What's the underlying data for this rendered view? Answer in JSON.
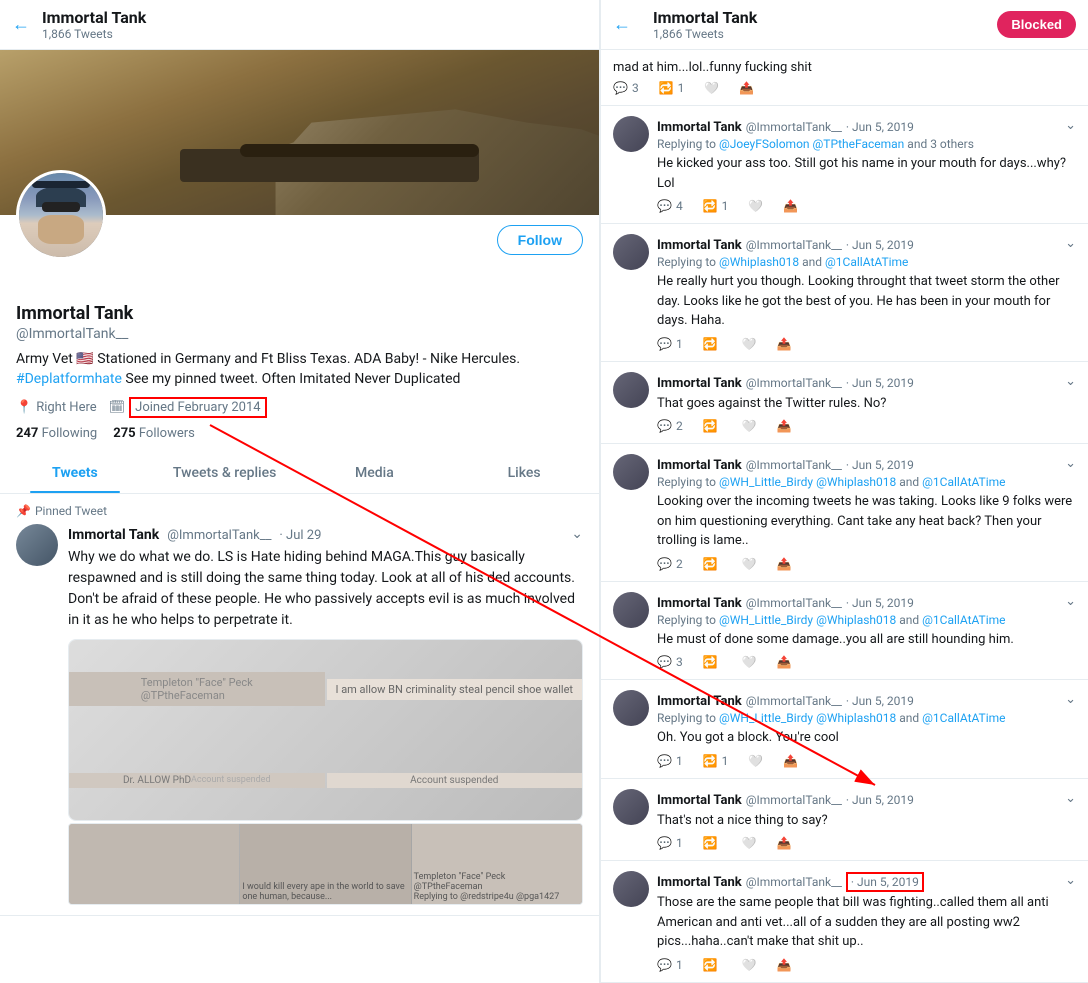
{
  "left": {
    "back_label": "←",
    "header": {
      "name": "Immortal Tank",
      "tweets_count": "1,866 Tweets"
    },
    "cover": "tank_cover",
    "avatar": "immortal_tank_avatar",
    "follow_label": "Follow",
    "profile": {
      "display_name": "Immortal Tank",
      "handle": "@ImmortalTank__",
      "bio": "Army Vet 🇺🇸 Stationed in Germany and Ft Bliss Texas. ADA Baby! - Nike Hercules. #Deplatformhate See my pinned tweet. Often Imitated Never Duplicated",
      "location": "Right Here",
      "joined": "Joined February 2014",
      "following_count": "247",
      "following_label": "Following",
      "followers_count": "275",
      "followers_label": "Followers"
    },
    "tabs": [
      {
        "label": "Tweets",
        "active": true
      },
      {
        "label": "Tweets & replies",
        "active": false
      },
      {
        "label": "Media",
        "active": false
      },
      {
        "label": "Likes",
        "active": false
      }
    ],
    "pinned_label": "Pinned Tweet",
    "pinned_tweet": {
      "author": "Immortal Tank",
      "handle": "@ImmortalTank__",
      "date": "· Jul 29",
      "text": "Why we do what we do. LS is Hate hiding behind MAGA.This guy basically respawned and is still doing the same thing today. Look at all of his ded accounts. Don't be afraid of these people. He who passively accepts evil is as much involved in it as he who helps to perpetrate it."
    }
  },
  "right": {
    "back_label": "←",
    "header": {
      "name": "Immortal Tank",
      "tweets_count": "1,866 Tweets"
    },
    "blocked_label": "Blocked",
    "top_text": "mad at him...lol..funny fucking shit",
    "top_actions": {
      "reply": "3",
      "retweet": "1",
      "like": "",
      "share": ""
    },
    "tweets": [
      {
        "author": "Immortal Tank",
        "handle": "@ImmortalTank__",
        "date": "Jun 5, 2019",
        "reply_to": "Replying to @JoeyFSolomon @TPtheFaceman and 3 others",
        "text": "He kicked your ass too. Still got his name in your mouth for days...why? Lol",
        "actions": {
          "reply": "4",
          "retweet": "1",
          "like": "",
          "share": ""
        }
      },
      {
        "author": "Immortal Tank",
        "handle": "@ImmortalTank__",
        "date": "Jun 5, 2019",
        "reply_to": "Replying to @Whiplash018 and @1CallAtATime",
        "text": "He really hurt you though. Looking throught that tweet storm the other day. Looks like he got the best of you. He has been in your mouth for days. Haha.",
        "actions": {
          "reply": "1",
          "retweet": "",
          "like": "",
          "share": ""
        }
      },
      {
        "author": "Immortal Tank",
        "handle": "@ImmortalTank__",
        "date": "Jun 5, 2019",
        "reply_to": null,
        "text": "That goes against the Twitter rules. No?",
        "actions": {
          "reply": "2",
          "retweet": "",
          "like": "",
          "share": ""
        }
      },
      {
        "author": "Immortal Tank",
        "handle": "@ImmortalTank__",
        "date": "Jun 5, 2019",
        "reply_to": "Replying to @WH_Little_Birdy @Whiplash018 and @1CallAtATime",
        "text": "Looking over the incoming tweets he was taking. Looks like 9 folks were on him questioning everything. Cant take any heat back? Then your trolling is lame..",
        "actions": {
          "reply": "2",
          "retweet": "",
          "like": "",
          "share": ""
        }
      },
      {
        "author": "Immortal Tank",
        "handle": "@ImmortalTank__",
        "date": "Jun 5, 2019",
        "reply_to": "Replying to @WH_Little_Birdy @Whiplash018 and @1CallAtATime",
        "text": "He must of done some damage..you all are still hounding him.",
        "actions": {
          "reply": "3",
          "retweet": "",
          "like": "",
          "share": ""
        }
      },
      {
        "author": "Immortal Tank",
        "handle": "@ImmortalTank__",
        "date": "Jun 5, 2019",
        "reply_to": "Replying to @WH_Little_Birdy @Whiplash018 and @1CallAtATime",
        "text": "Oh. You got a block. You're cool",
        "actions": {
          "reply": "1",
          "retweet": "1",
          "like": "",
          "share": ""
        }
      },
      {
        "author": "Immortal Tank",
        "handle": "@ImmortalTank__",
        "date": "Jun 5, 2019",
        "reply_to": null,
        "text": "That's not a nice thing to say?",
        "actions": {
          "reply": "1",
          "retweet": "",
          "like": "",
          "share": ""
        }
      },
      {
        "author": "Immortal Tank",
        "handle": "@ImmortalTank__",
        "date": "Jun 5, 2019",
        "date_annotated": true,
        "reply_to": null,
        "text": "Those are the same people that bill was fighting..called them all anti American and anti vet...all of a sudden they are all posting ww2 pics...haha..can't make that shit up..",
        "actions": {
          "reply": "1",
          "retweet": "",
          "like": "",
          "share": ""
        }
      }
    ]
  },
  "icons": {
    "back": "←",
    "pin": "📌",
    "location": "📍",
    "calendar": "🗓",
    "reply": "💬",
    "retweet": "🔁",
    "like": "🤍",
    "share": "📤",
    "chevron": "⌄"
  }
}
